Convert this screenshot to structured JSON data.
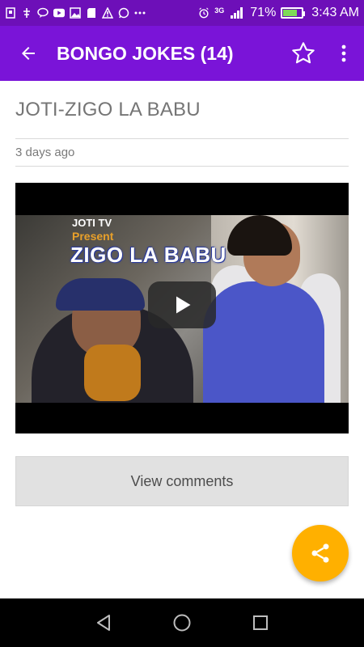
{
  "status_bar": {
    "battery_percent": "71%",
    "battery_level": 0.71,
    "network": "3G",
    "time": "3:43 AM",
    "icons": [
      "usb-icon",
      "usb-debug-icon",
      "chat-icon",
      "youtube-icon",
      "image-icon",
      "sd-card-icon",
      "warning-icon",
      "whatsapp-icon",
      "more-notifications-icon",
      "alarm-icon",
      "signal-icon",
      "battery-icon"
    ]
  },
  "app_bar": {
    "title": "BONGO JOKES (14)",
    "color": "#7a14d8",
    "icons": [
      "back-arrow-icon",
      "star-outline-icon",
      "more-vert-icon"
    ]
  },
  "post": {
    "title": "JOTI-ZIGO LA BABU",
    "date": "3 days ago",
    "video": {
      "overlay_channel": "JOTI TV",
      "overlay_present": "Present",
      "overlay_title": "ZIGO LA BABU",
      "play_icon": "play-icon"
    }
  },
  "actions": {
    "view_comments_label": "View comments",
    "share_fab_icon": "share-icon",
    "share_fab_color": "#ffb000"
  },
  "nav_bar": {
    "icons": [
      "back-triangle-icon",
      "home-circle-icon",
      "recents-square-icon"
    ]
  }
}
